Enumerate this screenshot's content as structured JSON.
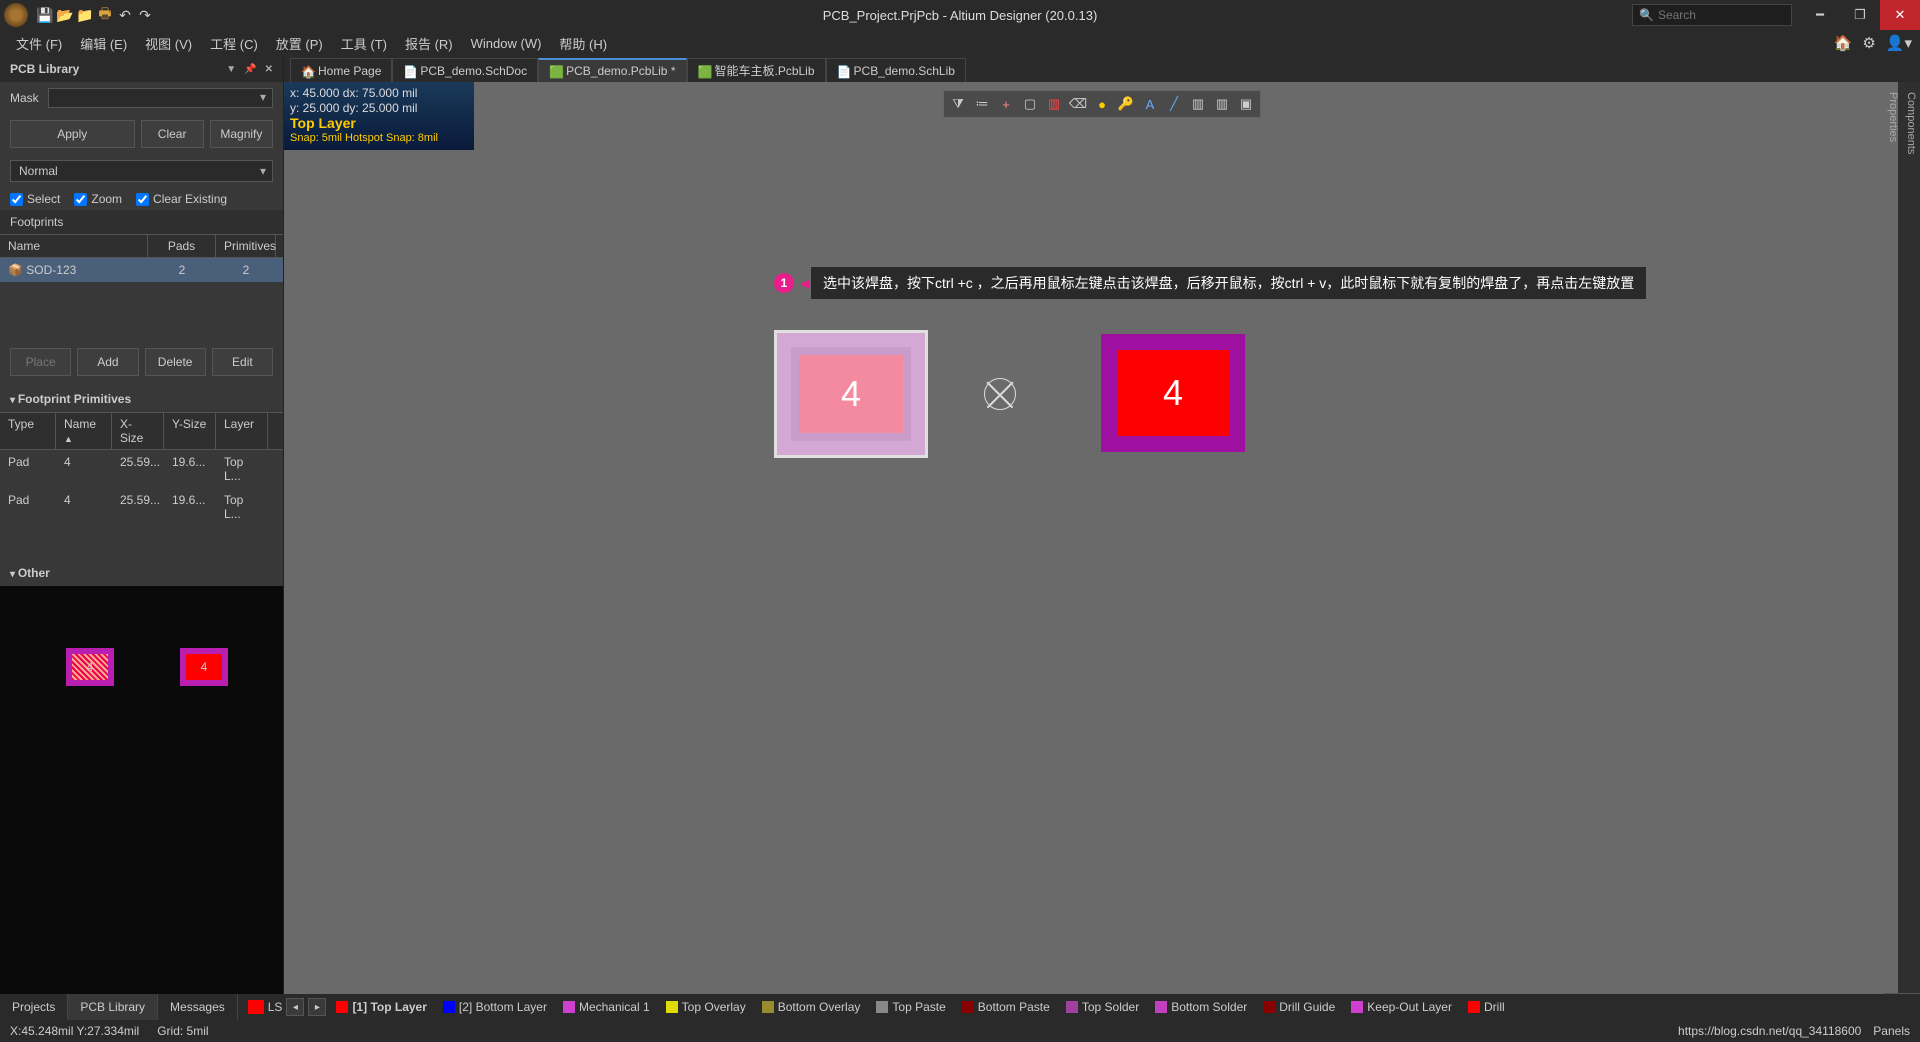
{
  "title": "PCB_Project.PrjPcb - Altium Designer (20.0.13)",
  "search_placeholder": "Search",
  "menus": {
    "file": "文件 (F)",
    "edit": "编辑 (E)",
    "view": "视图 (V)",
    "project": "工程 (C)",
    "place": "放置 (P)",
    "tools": "工具 (T)",
    "report": "报告 (R)",
    "window": "Window (W)",
    "help": "帮助 (H)"
  },
  "panel": {
    "title": "PCB Library",
    "mask_label": "Mask",
    "apply": "Apply",
    "clear": "Clear",
    "magnify": "Magnify",
    "mode": "Normal",
    "chk_select": "Select",
    "chk_zoom": "Zoom",
    "chk_clear": "Clear Existing",
    "footprints": "Footprints",
    "head_name": "Name",
    "head_pads": "Pads",
    "head_prim": "Primitives",
    "fp_rows": [
      {
        "name": "SOD-123",
        "pads": "2",
        "prim": "2"
      }
    ],
    "btn_place": "Place",
    "btn_add": "Add",
    "btn_delete": "Delete",
    "btn_edit": "Edit",
    "primitives_h": "Footprint Primitives",
    "ph_type": "Type",
    "ph_name": "Name",
    "ph_x": "X-Size",
    "ph_y": "Y-Size",
    "ph_layer": "Layer",
    "prim_rows": [
      {
        "type": "Pad",
        "name": "4",
        "x": "25.59...",
        "y": "19.6...",
        "layer": "Top L..."
      },
      {
        "type": "Pad",
        "name": "4",
        "x": "25.59...",
        "y": "19.6...",
        "layer": "Top L..."
      }
    ],
    "other_h": "Other",
    "prev_a": "4",
    "prev_b": "4"
  },
  "tabs": [
    {
      "label": "Home Page",
      "active": false,
      "icon": "home"
    },
    {
      "label": "PCB_demo.SchDoc",
      "active": false,
      "icon": "sch"
    },
    {
      "label": "PCB_demo.PcbLib *",
      "active": true,
      "icon": "pcb"
    },
    {
      "label": "智能车主板.PcbLib",
      "active": false,
      "icon": "pcb"
    },
    {
      "label": "PCB_demo.SchLib",
      "active": false,
      "icon": "sch"
    }
  ],
  "hud": {
    "line1": "x:   45.000   dx:   75.000 mil",
    "line2": "y:   25.000   dy:   25.000 mil",
    "layer": "Top Layer",
    "snap": "Snap: 5mil Hotspot Snap: 8mil"
  },
  "annotation": {
    "num": "1",
    "text": "选中该焊盘，按下ctrl +c ，之后再用鼠标左键点击该焊盘，后移开鼠标，按ctrl + v，此时鼠标下就有复制的焊盘了，再点击左键放置"
  },
  "pad_a": "4",
  "pad_b": "4",
  "bottom_tabs": {
    "projects": "Projects",
    "pcblib": "PCB Library",
    "messages": "Messages"
  },
  "ls": "LS",
  "layers": [
    {
      "name": "[1] Top Layer",
      "color": "#f00",
      "active": true
    },
    {
      "name": "[2] Bottom Layer",
      "color": "#00f"
    },
    {
      "name": "Mechanical 1",
      "color": "#d040d0"
    },
    {
      "name": "Top Overlay",
      "color": "#dd0"
    },
    {
      "name": "Bottom Overlay",
      "color": "#9a8a30"
    },
    {
      "name": "Top Paste",
      "color": "#888"
    },
    {
      "name": "Bottom Paste",
      "color": "#800"
    },
    {
      "name": "Top Solder",
      "color": "#a040a0"
    },
    {
      "name": "Bottom Solder",
      "color": "#c040c0"
    },
    {
      "name": "Drill Guide",
      "color": "#800"
    },
    {
      "name": "Keep-Out Layer",
      "color": "#d040d0"
    },
    {
      "name": "Drill",
      "color": "#f00"
    }
  ],
  "status": {
    "coord": "X:45.248mil Y:27.334mil",
    "grid": "Grid: 5mil",
    "panels": "Panels",
    "watermark": "https://blog.csdn.net/qq_34118600"
  },
  "vside": {
    "components": "Components",
    "properties": "Properties"
  }
}
